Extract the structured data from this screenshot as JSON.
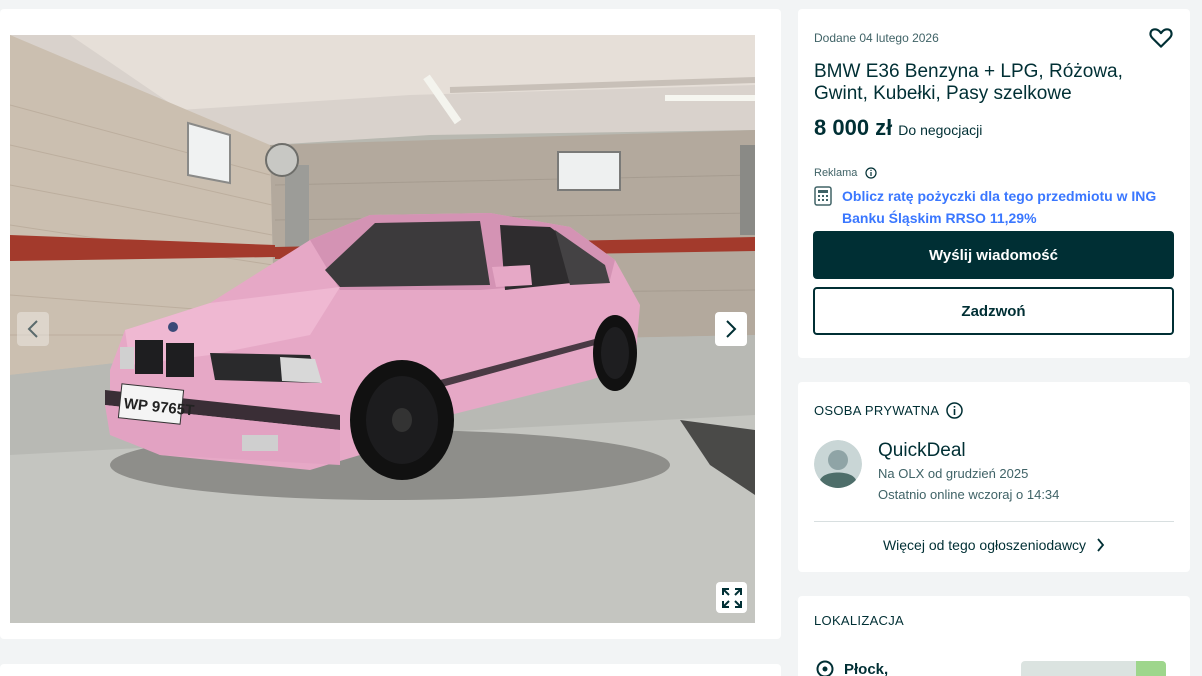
{
  "gallery": {
    "photo_alt": "",
    "plate_text": "WP 9765T",
    "prev_icon": "chevron-left-icon",
    "next_icon": "chevron-right-icon",
    "fullscreen_icon": "expand-icon"
  },
  "ad": {
    "added_date": "Dodane 04 lutego 2026",
    "title": "BMW E36 Benzyna + LPG, Różowa, Gwint, Kubełki, Pasy szelkowe",
    "price": "8 000 zł",
    "negotiable": "Do negocjacji",
    "ad_label": "Reklama",
    "loan_link": "Oblicz ratę pożyczki dla tego przedmiotu w ING Banku Śląskim RRSO 11,29%",
    "message_button": "Wyślij wiadomość",
    "call_button": "Zadzwoń"
  },
  "seller": {
    "type": "OSOBA PRYWATNA",
    "name": "QuickDeal",
    "since": "Na OLX od grudzień 2025",
    "last_online": "Ostatnio online wczoraj o 14:34",
    "more_link": "Więcej od tego ogłoszeniodawcy"
  },
  "location": {
    "heading": "LOKALIZACJA",
    "city": "Płock,"
  },
  "colors": {
    "primary": "#002f34",
    "link": "#3a77ff",
    "background": "#f2f4f5",
    "car_pink": "#e8a9c8"
  }
}
